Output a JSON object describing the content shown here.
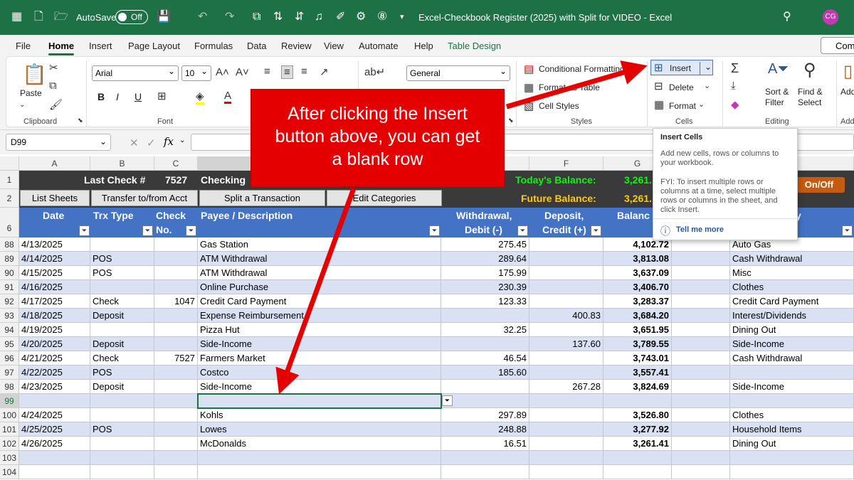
{
  "titlebar": {
    "autosave": "AutoSave",
    "toggle": "Off",
    "title": "Excel-Checkbook Register (2025) with Split for VIDEO  -  Excel",
    "avatar": "CG"
  },
  "menu": [
    "File",
    "Home",
    "Insert",
    "Page Layout",
    "Formulas",
    "Data",
    "Review",
    "View",
    "Automate",
    "Help",
    "Table Design"
  ],
  "comments_btn": "Com",
  "ribbon": {
    "clipboard": {
      "paste": "Paste",
      "group": "Clipboard"
    },
    "font": {
      "family": "Arial",
      "size": "10",
      "group": "Font",
      "b": "B",
      "i": "I",
      "u": "U"
    },
    "number": {
      "format": "General"
    },
    "styles": {
      "cond": "Conditional Formatting",
      "fmt_table": "Format as Table",
      "cell_styles": "Cell Styles",
      "group": "Styles"
    },
    "cells": {
      "insert": "Insert",
      "delete": "Delete",
      "format": "Format",
      "group": "Cells"
    },
    "editing": {
      "sort": "Sort &",
      "filter": "Filter",
      "find": "Find &",
      "select": "Select",
      "group": "Editing"
    },
    "addins": {
      "add": "Add",
      "group": "Add"
    }
  },
  "namebox": "D99",
  "fx": "fx",
  "tooltip": {
    "title": "Insert Cells",
    "body": "Add new cells, rows or columns to your workbook.",
    "fyi": "FYI: To insert multiple rows or columns at a time, select multiple rows or columns in the sheet, and click Insert.",
    "link": "Tell me more"
  },
  "callout": {
    "line1": "After clicking the Insert",
    "line2": "button above, you can get",
    "line3": "a blank row"
  },
  "columns": [
    "A",
    "B",
    "C",
    "D",
    "E",
    "F",
    "G"
  ],
  "sheet": {
    "last_check_label": "Last Check #",
    "last_check": "7527",
    "checking": "Checking",
    "todays_balance_label": "Today's Balance:",
    "todays_balance": "3,261.",
    "future_balance_label": "Future Balance:",
    "future_balance": "3,261.",
    "onoff": "On/Off",
    "buttons": [
      "List Sheets",
      "Transfer to/from Acct",
      "Split a Transaction",
      "Edit Categories"
    ],
    "headers": {
      "date": "Date",
      "trx": "Trx Type",
      "check1": "Check",
      "check2": "No.",
      "payee": "Payee / Description",
      "wd1": "Withdrawal,",
      "wd2": "Debit (-)",
      "dep1": "Deposit,",
      "dep2": "Credit (+)",
      "bal": "Balanc",
      "cat": "y"
    }
  },
  "row_numbers": [
    "1",
    "2",
    "6",
    "88",
    "89",
    "90",
    "91",
    "92",
    "93",
    "94",
    "95",
    "96",
    "97",
    "98",
    "99",
    "100",
    "101",
    "102",
    "103",
    "104"
  ],
  "rows": [
    {
      "date": "4/13/2025",
      "trx": "",
      "check": "",
      "payee": "Gas Station",
      "wd": "275.45",
      "dep": "",
      "bal": "4,102.72",
      "cat": "Auto Gas"
    },
    {
      "date": "4/14/2025",
      "trx": "POS",
      "check": "",
      "payee": "ATM Withdrawal",
      "wd": "289.64",
      "dep": "",
      "bal": "3,813.08",
      "cat": "Cash Withdrawal"
    },
    {
      "date": "4/15/2025",
      "trx": "POS",
      "check": "",
      "payee": "ATM Withdrawal",
      "wd": "175.99",
      "dep": "",
      "bal": "3,637.09",
      "cat": "Misc"
    },
    {
      "date": "4/16/2025",
      "trx": "",
      "check": "",
      "payee": "Online Purchase",
      "wd": "230.39",
      "dep": "",
      "bal": "3,406.70",
      "cat": "Clothes"
    },
    {
      "date": "4/17/2025",
      "trx": "Check",
      "check": "1047",
      "payee": "Credit Card Payment",
      "wd": "123.33",
      "dep": "",
      "bal": "3,283.37",
      "cat": "Credit Card Payment"
    },
    {
      "date": "4/18/2025",
      "trx": "Deposit",
      "check": "",
      "payee": "Expense Reimbursement",
      "wd": "",
      "dep": "400.83",
      "bal": "3,684.20",
      "cat": "Interest/Dividends"
    },
    {
      "date": "4/19/2025",
      "trx": "",
      "check": "",
      "payee": "Pizza Hut",
      "wd": "32.25",
      "dep": "",
      "bal": "3,651.95",
      "cat": "Dining Out"
    },
    {
      "date": "4/20/2025",
      "trx": "Deposit",
      "check": "",
      "payee": "Side-Income",
      "wd": "",
      "dep": "137.60",
      "bal": "3,789.55",
      "cat": "Side-Income"
    },
    {
      "date": "4/21/2025",
      "trx": "Check",
      "check": "7527",
      "payee": "Farmers Market",
      "wd": "46.54",
      "dep": "",
      "bal": "3,743.01",
      "cat": "Cash Withdrawal"
    },
    {
      "date": "4/22/2025",
      "trx": "POS",
      "check": "",
      "payee": "Costco",
      "wd": "185.60",
      "dep": "",
      "bal": "3,557.41",
      "cat": ""
    },
    {
      "date": "4/23/2025",
      "trx": "Deposit",
      "check": "",
      "payee": "Side-Income",
      "wd": "",
      "dep": "267.28",
      "bal": "3,824.69",
      "cat": "Side-Income"
    },
    {
      "date": "",
      "trx": "",
      "check": "",
      "payee": "",
      "wd": "",
      "dep": "",
      "bal": "",
      "cat": ""
    },
    {
      "date": "4/24/2025",
      "trx": "",
      "check": "",
      "payee": "Kohls",
      "wd": "297.89",
      "dep": "",
      "bal": "3,526.80",
      "cat": "Clothes"
    },
    {
      "date": "4/25/2025",
      "trx": "POS",
      "check": "",
      "payee": "Lowes",
      "wd": "248.88",
      "dep": "",
      "bal": "3,277.92",
      "cat": "Household Items"
    },
    {
      "date": "4/26/2025",
      "trx": "",
      "check": "",
      "payee": "McDonalds",
      "wd": "16.51",
      "dep": "",
      "bal": "3,261.41",
      "cat": "Dining Out"
    },
    {
      "date": "",
      "trx": "",
      "check": "",
      "payee": "",
      "wd": "",
      "dep": "",
      "bal": "",
      "cat": ""
    },
    {
      "date": "",
      "trx": "",
      "check": "",
      "payee": "",
      "wd": "",
      "dep": "",
      "bal": "",
      "cat": ""
    }
  ],
  "colors": {
    "excel_green": "#1e7145",
    "header_blue": "#4472c4",
    "band": "#d9e1f2",
    "callout_red": "#e50000",
    "balance_green": "#00ff00",
    "balance_yellow": "#ffcc00",
    "onoff": "#c55a11"
  }
}
